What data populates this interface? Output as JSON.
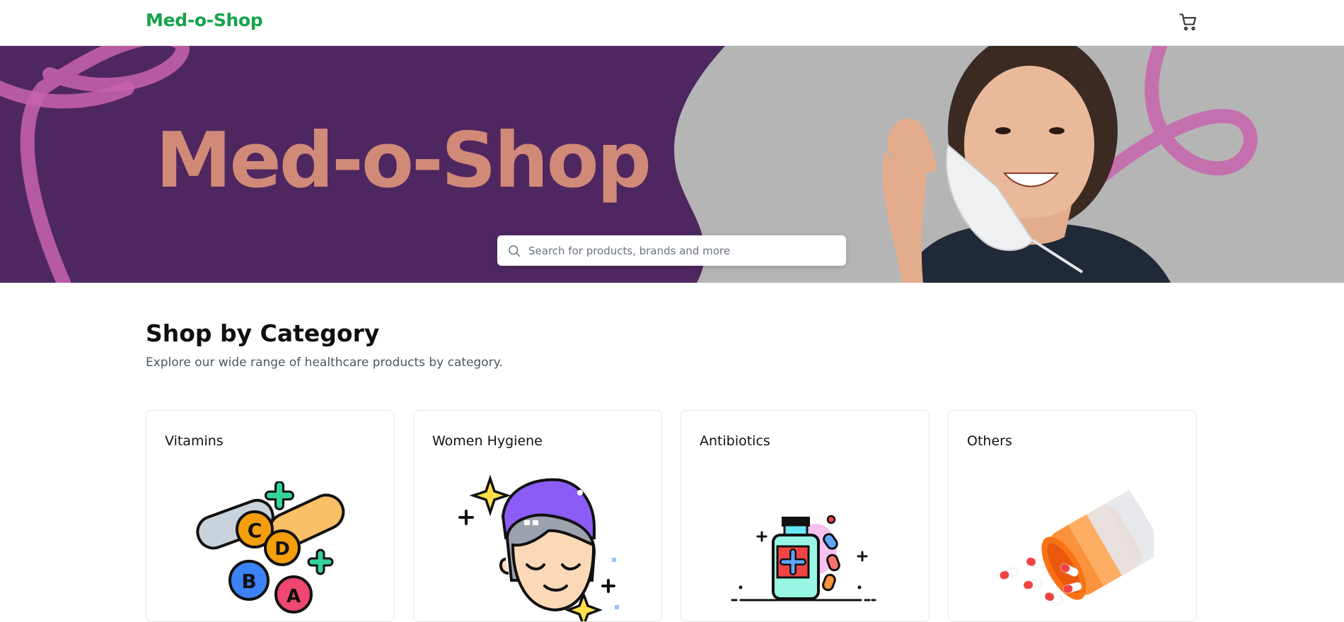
{
  "header": {
    "brand": "Med-o-Shop",
    "cart_icon": "shopping-cart-icon"
  },
  "hero": {
    "title": "Med-o-Shop",
    "search": {
      "placeholder": "Search for products, brands and more",
      "value": "",
      "icon": "search-icon"
    }
  },
  "category_section": {
    "title": "Shop by Category",
    "subtitle": "Explore our wide range of healthcare products by category.",
    "categories": [
      {
        "label": "Vitamins",
        "icon": "vitamins-icon"
      },
      {
        "label": "Women Hygiene",
        "icon": "women-hygiene-icon"
      },
      {
        "label": "Antibiotics",
        "icon": "antibiotics-icon"
      },
      {
        "label": "Others",
        "icon": "pill-bottle-icon"
      }
    ]
  },
  "colors": {
    "brand": "#16a34a",
    "hero_purple": "#4f2760",
    "hero_pink": "#d18a78"
  }
}
